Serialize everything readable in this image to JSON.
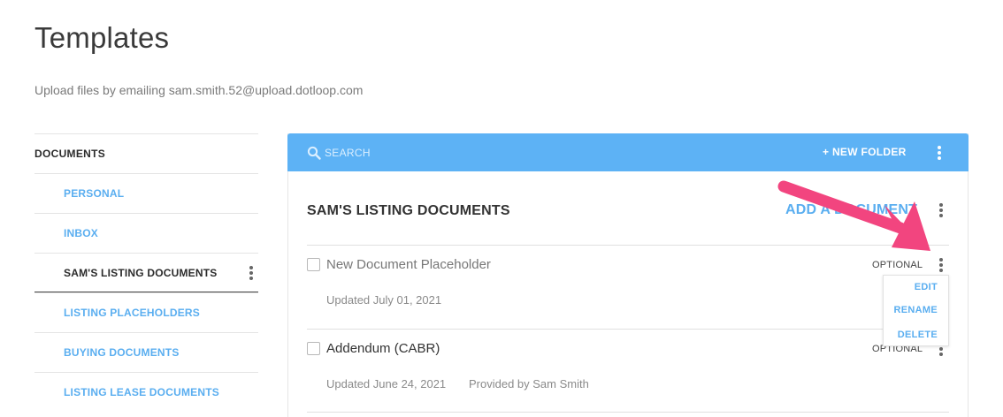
{
  "page": {
    "title": "Templates",
    "subtitle": "Upload files by emailing sam.smith.52@upload.dotloop.com"
  },
  "sidebar": {
    "header": "DOCUMENTS",
    "items": [
      {
        "label": "PERSONAL",
        "active": false
      },
      {
        "label": "INBOX",
        "active": false
      },
      {
        "label": "SAM'S LISTING DOCUMENTS",
        "active": true
      },
      {
        "label": "LISTING PLACEHOLDERS",
        "active": false
      },
      {
        "label": "BUYING DOCUMENTS",
        "active": false
      },
      {
        "label": "LISTING LEASE DOCUMENTS",
        "active": false
      }
    ]
  },
  "toolbar": {
    "search_placeholder": "SEARCH",
    "new_folder_label": "+ NEW FOLDER",
    "background_color": "#5db2f5"
  },
  "folder": {
    "title": "SAM'S LISTING DOCUMENTS",
    "add_document_label": "ADD A DOCUMENT"
  },
  "documents": [
    {
      "name": "New Document Placeholder",
      "updated": "Updated July 01, 2021",
      "provided_by": "",
      "badge": "OPTIONAL",
      "placeholder": true
    },
    {
      "name": "Addendum (CABR)",
      "updated": "Updated June 24, 2021",
      "provided_by": "Provided by Sam Smith",
      "badge": "OPTIONAL",
      "placeholder": false
    }
  ],
  "context_menu": {
    "items": [
      "EDIT",
      "RENAME",
      "DELETE"
    ]
  },
  "colors": {
    "accent": "#5aaef0",
    "annotation_arrow": "#f2457f"
  },
  "icons": {
    "search": "search-icon",
    "more": "kebab-menu-icon",
    "annotation": "pink-arrow-icon"
  }
}
